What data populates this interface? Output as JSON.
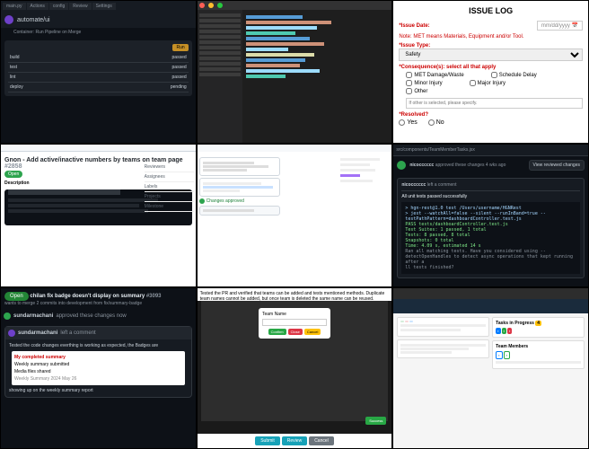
{
  "tile1": {
    "tabs": [
      "main.py",
      "Actions",
      "config",
      "Review",
      "Settings"
    ],
    "user": "automate/ui",
    "subtitle": "Container: Run Pipeline on Merge",
    "button": "Run",
    "rows": [
      {
        "a": "build",
        "b": "passed"
      },
      {
        "a": "test",
        "b": "passed"
      },
      {
        "a": "lint",
        "b": "passed"
      },
      {
        "a": "deploy",
        "b": "pending"
      }
    ]
  },
  "tile3": {
    "title": "ISSUE LOG",
    "date_label": "*Issue Date:",
    "date_value": "mm/dd/yyyy",
    "note": "Note: MET means Materials, Equipment and/or Tool.",
    "type_label": "*Issue Type:",
    "type_value": "Safety",
    "conseq_label": "*Consequence(s): select all that apply",
    "c1": "MET Damage/Waste",
    "c2": "Schedule Delay",
    "c3": "Minor Injury",
    "c4": "Major Injury",
    "c5": "Other",
    "other_ph": "If other is selected, please specify.",
    "resolved_label": "*Resolved?",
    "yes": "Yes",
    "no": "No"
  },
  "tile4": {
    "title": "Gnon - Add active/inactive numbers by teams on team page",
    "pr_num": "#2858",
    "badge": "Open",
    "desc_h": "Description",
    "side": [
      "Reviewers",
      "Assignees",
      "Labels",
      "Projects",
      "Milestone"
    ]
  },
  "tile5": {
    "approved": "Changes approved"
  },
  "tile6": {
    "path": "src/components/TeamMemberTasks.jsx",
    "approver": "nicocccccc",
    "approved_txt": "approved these changes 4 wks ago",
    "review_btn": "View reviewed changes",
    "comment_user": "nicocccccc",
    "comment_action": "left a comment",
    "test_header": "All unit tests passed successfully",
    "term_lines": [
      "> hgn-rest@1.0 test /Users/username/HGNRest",
      "> jest --watchAll=false --silent --runInBand=true --testPathPattern=dashboardController.test.js",
      "PASS  tests/dashboardController.test.js",
      "Test Suites: 1 passed, 1 total",
      "Tests:       8 passed, 8 total",
      "Snapshots:   0 total",
      "Time:        4.09 s, estimated 14 s",
      "Ran all matching tests. Have you considered using --detectOpenHandles to detect async operations that kept running after a",
      "ll tests finished?"
    ]
  },
  "tile7": {
    "badge": "Open",
    "title": "chilan fix badge doesn't display on summary",
    "pr_num": "#3093",
    "subline": "wants to merge 2 commits into development from fix/summary-badge",
    "approver": "sundarmachani",
    "approved_txt": "approved these changes now",
    "comment_user": "sundarmachani",
    "comment_action": "left a comment",
    "body1": "Tested the code changes everthing is working as expected, the Badges are",
    "body2": "showing up on the weekly summary report",
    "panel_items": [
      "My completed summary",
      "Weekly summary submitted",
      "Media files shared",
      "Weekly Summary 2024 May 26"
    ]
  },
  "tile8": {
    "toptext": "Tested the PR and verified that teams can be added and tests mentioned methods. Duplicate team names cannot be added, but once team is deleted the same name can be reused.",
    "modal_text": "Team Name",
    "btn_confirm": "Confirm",
    "btn_close": "Close",
    "btn_cancel": "Cancel",
    "bot_b1": "Submit",
    "bot_b2": "Review",
    "bot_b3": "Cancel",
    "green": "Success"
  },
  "tile9": {
    "widget1": "Tasks in Progress",
    "count1": "4",
    "widget2": "Team Members"
  }
}
